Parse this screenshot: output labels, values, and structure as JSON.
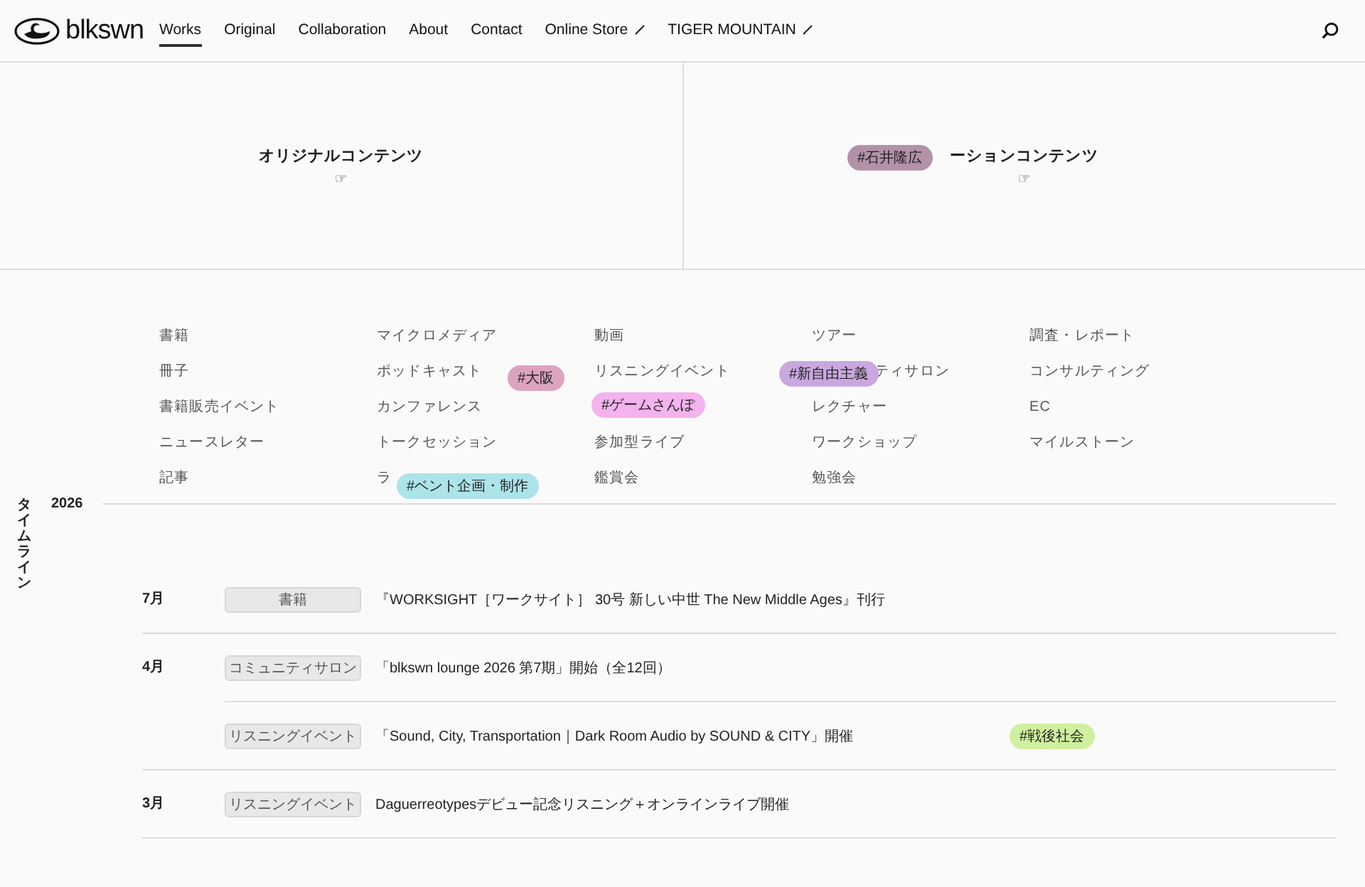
{
  "header": {
    "logo": "blkswn",
    "nav": [
      {
        "label": "Works",
        "selected": true,
        "external": false
      },
      {
        "label": "Original",
        "selected": false,
        "external": false
      },
      {
        "label": "Collaboration",
        "selected": false,
        "external": false
      },
      {
        "label": "About",
        "selected": false,
        "external": false
      },
      {
        "label": "Contact",
        "selected": false,
        "external": false
      },
      {
        "label": "Online Store",
        "selected": false,
        "external": true
      },
      {
        "label": "TIGER MOUNTAIN",
        "selected": false,
        "external": true
      }
    ]
  },
  "hero": [
    {
      "title": "オリジナルコンテンツ",
      "pointer": "☞"
    },
    {
      "title": "ーションコンテンツ",
      "pointer": "☞"
    }
  ],
  "categories": [
    [
      "書籍",
      "冊子",
      "書籍販売イベント",
      "ニュースレター",
      "記事"
    ],
    [
      "マイクロメディア",
      "ポッドキャスト",
      "カンファレンス",
      "トークセッション",
      "ラ"
    ],
    [
      "動画",
      "リスニングイベント",
      "参加型ライブ",
      "鑑賞会"
    ],
    [
      "ツアー",
      "ティサロン",
      "レクチャー",
      "ワークショップ",
      "勉強会"
    ],
    [
      "調査・レポート",
      "コンサルティング",
      "EC",
      "マイルストーン"
    ]
  ],
  "floating_tags": [
    {
      "label": "#石井隆広",
      "color": "#b391a9"
    },
    {
      "label": "#大阪",
      "color": "#dca3c0"
    },
    {
      "label": "#新自由主義",
      "color": "#c9a8e0"
    },
    {
      "label": "#ゲームさんぽ",
      "color": "#f3b3ee"
    },
    {
      "label": "#ベント企画・制作",
      "color": "#ace4ea"
    }
  ],
  "timeline": {
    "label": "タイムライン",
    "year": "2026",
    "months": [
      {
        "month": "7月",
        "entries": [
          {
            "category": "書籍",
            "title": "『WORKSIGHT［ワークサイト］ 30号 新しい中世 The New Middle Ages』刊行"
          }
        ]
      },
      {
        "month": "4月",
        "entries": [
          {
            "category": "コミュニティサロン",
            "title": "「blkswn lounge 2026 第7期」開始（全12回）"
          },
          {
            "category": "リスニングイベント",
            "title": "「Sound, City, Transportation｜Dark Room Audio by SOUND & CITY」開催",
            "tag": {
              "label": "#戦後社会",
              "color": "#cff09e"
            }
          }
        ]
      },
      {
        "month": "3月",
        "entries": [
          {
            "category": "リスニングイベント",
            "title": "Daguerreotypesデビュー記念リスニング＋オンラインライブ開催"
          }
        ]
      }
    ]
  }
}
